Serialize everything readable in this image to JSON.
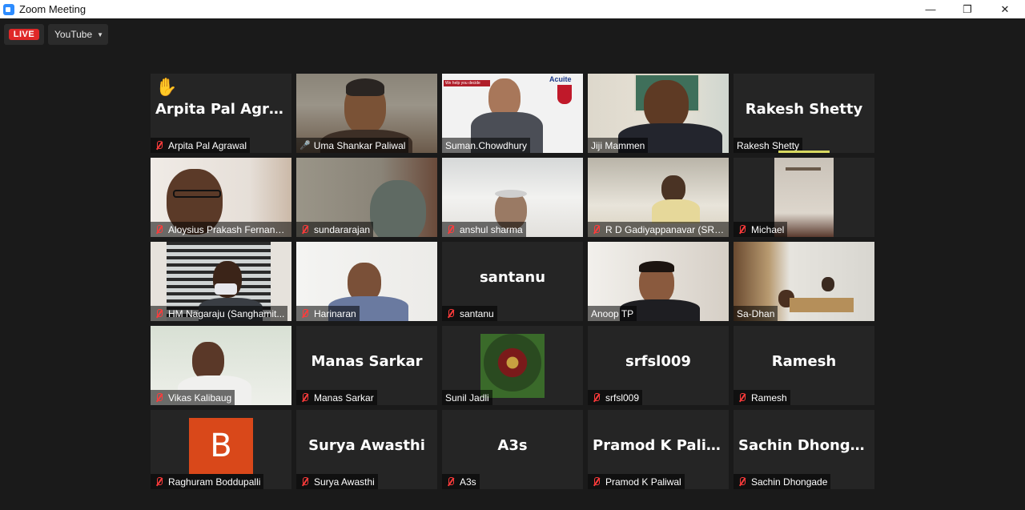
{
  "window": {
    "title": "Zoom Meeting"
  },
  "topbar": {
    "live_label": "LIVE",
    "stream_target": "YouTube"
  },
  "participants": [
    {
      "name": "Arpita Pal Agrawal",
      "display": "Arpita Pal Agra..."
    },
    {
      "name": "Uma Shankar Paliwal"
    },
    {
      "name": "Suman.Chowdhury"
    },
    {
      "name": "Jiji Mammen"
    },
    {
      "name": "Rakesh Shetty",
      "display": "Rakesh Shetty"
    },
    {
      "name": "Aloysius Prakash Fernand..."
    },
    {
      "name": "sundararajan"
    },
    {
      "name": "anshul sharma"
    },
    {
      "name": "R D Gadiyappanavar (SRF..."
    },
    {
      "name": "Michael"
    },
    {
      "name": "HM Nagaraju (Sanghamit..."
    },
    {
      "name": "Harinaran"
    },
    {
      "name": "santanu",
      "display": "santanu"
    },
    {
      "name": "Anoop TP"
    },
    {
      "name": "Sa-Dhan"
    },
    {
      "name": "Vikas Kalibaug"
    },
    {
      "name": "Manas Sarkar",
      "display": "Manas Sarkar"
    },
    {
      "name": "Sunil Jadli"
    },
    {
      "name": "srfsl009",
      "display": "srfsl009"
    },
    {
      "name": "Ramesh",
      "display": "Ramesh"
    },
    {
      "name": "Raghuram Boddupalli",
      "avatar_letter": "B"
    },
    {
      "name": "Surya Awasthi",
      "display": "Surya Awasthi"
    },
    {
      "name": "A3s",
      "display": "A3s"
    },
    {
      "name": "Pramod K Paliwal",
      "display": "Pramod K Paliwal"
    },
    {
      "name": "Sachin Dhongade",
      "display": "Sachin Dhongade"
    }
  ],
  "suman_video_text": {
    "tagline": "We help you decide",
    "brand": "Acuite"
  },
  "colors": {
    "live_red": "#e02828",
    "active_speaker": "#c8d85a",
    "muted_icon": "#ff3b3b",
    "avatar_b": "#d9481a"
  }
}
